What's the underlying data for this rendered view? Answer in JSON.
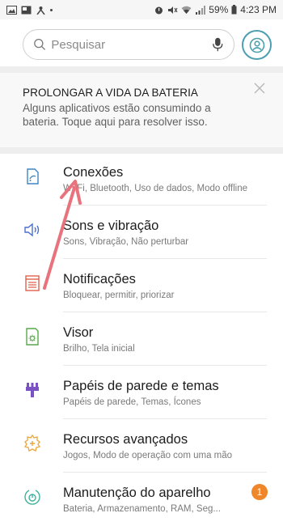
{
  "status_bar": {
    "battery_percent": "59%",
    "time": "4:23 PM"
  },
  "search": {
    "placeholder": "Pesquisar"
  },
  "battery_tip": {
    "title": "PROLONGAR A VIDA DA BATERIA",
    "body": "Alguns aplicativos estão consumindo a bateria. Toque aqui para resolver isso."
  },
  "menu": [
    {
      "title": "Conexões",
      "subtitle": "Wi-Fi, Bluetooth, Uso de dados, Modo offline",
      "icon": "connections-icon",
      "color": "#3f86c4"
    },
    {
      "title": "Sons e vibração",
      "subtitle": "Sons, Vibração, Não perturbar",
      "icon": "sound-icon",
      "color": "#4a6fd1"
    },
    {
      "title": "Notificações",
      "subtitle": "Bloquear, permitir, priorizar",
      "icon": "notifications-icon",
      "color": "#e0614a"
    },
    {
      "title": "Visor",
      "subtitle": "Brilho, Tela inicial",
      "icon": "display-icon",
      "color": "#58a84b"
    },
    {
      "title": "Papéis de parede e temas",
      "subtitle": "Papéis de parede, Temas, Ícones",
      "icon": "paintbrush-icon",
      "color": "#7a52c4"
    },
    {
      "title": "Recursos avançados",
      "subtitle": "Jogos, Modo de operação com uma mão",
      "icon": "gear-plus-icon",
      "color": "#e8a63a"
    },
    {
      "title": "Manutenção do aparelho",
      "subtitle": "Bateria, Armazenamento, RAM, Seg...",
      "icon": "maintenance-icon",
      "color": "#3cb39a",
      "badge": "1"
    }
  ],
  "colors": {
    "accent": "#4d9fb0",
    "badge": "#f0862a",
    "arrow": "#e8737d"
  }
}
